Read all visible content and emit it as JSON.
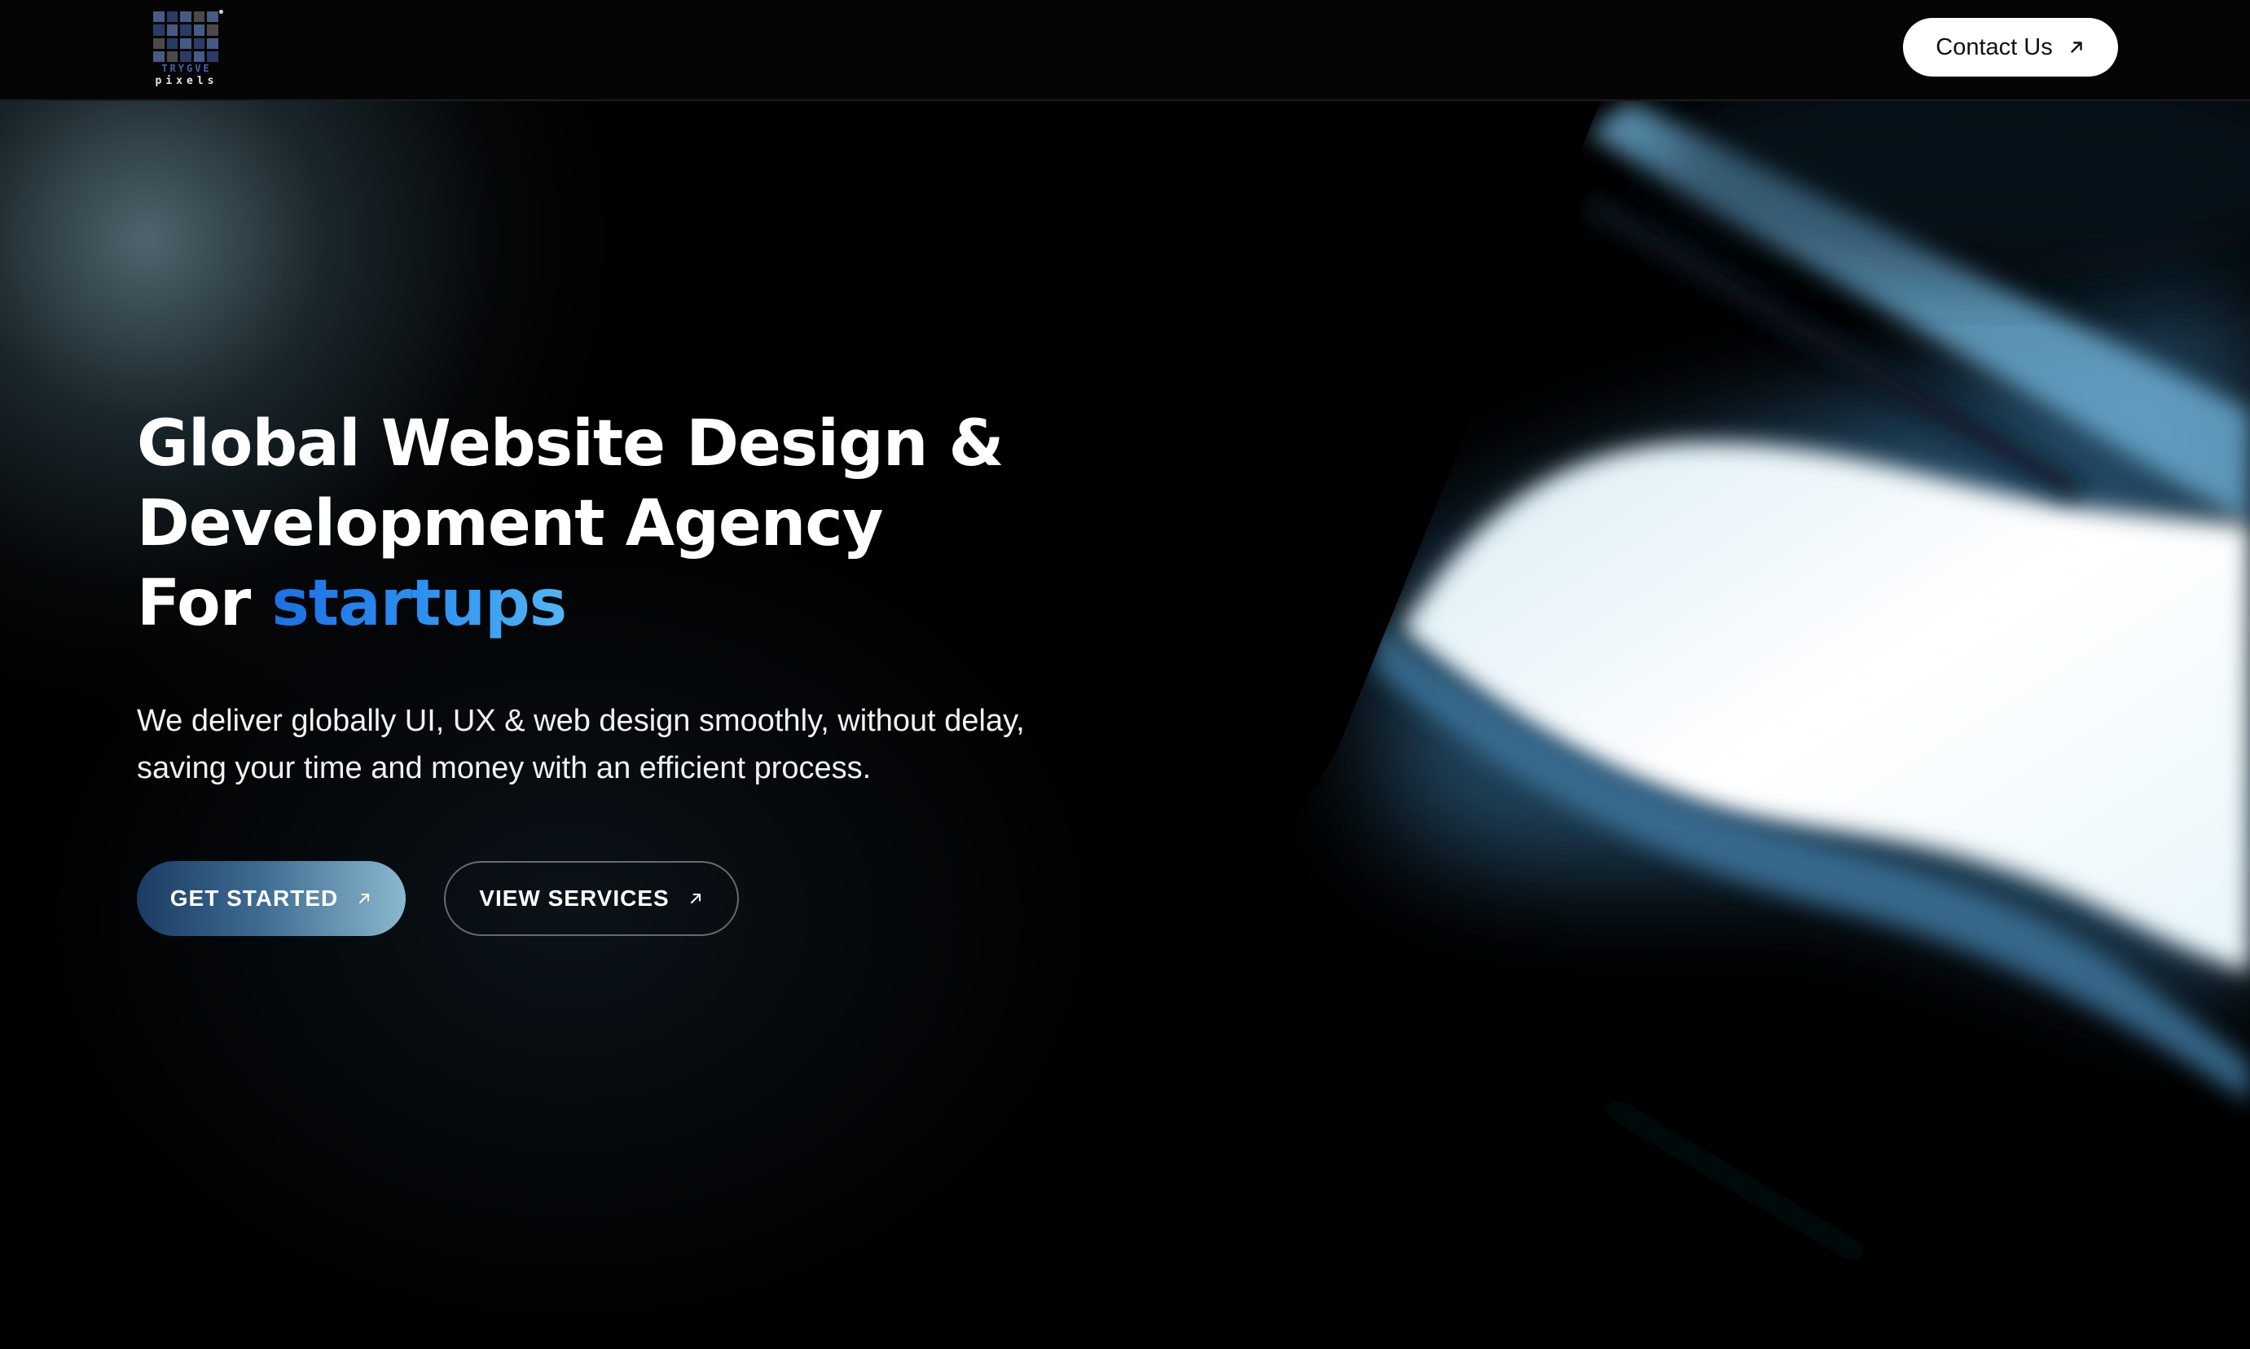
{
  "header": {
    "logo": {
      "top_text": "TRYGVE",
      "bottom_text": "pixels",
      "icon": "pixel-grid-logo-icon"
    },
    "contact_button": {
      "label": "Contact Us",
      "icon": "arrow-up-right-icon"
    }
  },
  "hero": {
    "title_line1": "Global Website Design &",
    "title_line2": "Development Agency",
    "title_line3_prefix": "For ",
    "title_accent": "startups",
    "subtitle_line1": "We deliver globally UI, UX & web design smoothly, without delay,",
    "subtitle_line2": "saving your time and money with an efficient process.",
    "primary_button": {
      "label": "GET STARTED",
      "icon": "arrow-up-right-icon"
    },
    "secondary_button": {
      "label": "VIEW SERVICES",
      "icon": "arrow-up-right-icon"
    }
  },
  "colors": {
    "background": "#000000",
    "accent_start": "#1d6fe3",
    "accent_end": "#52b6f5",
    "primary_button_start": "#1b3b62",
    "primary_button_end": "#8ab8cf",
    "contact_button_bg": "#ffffff"
  }
}
